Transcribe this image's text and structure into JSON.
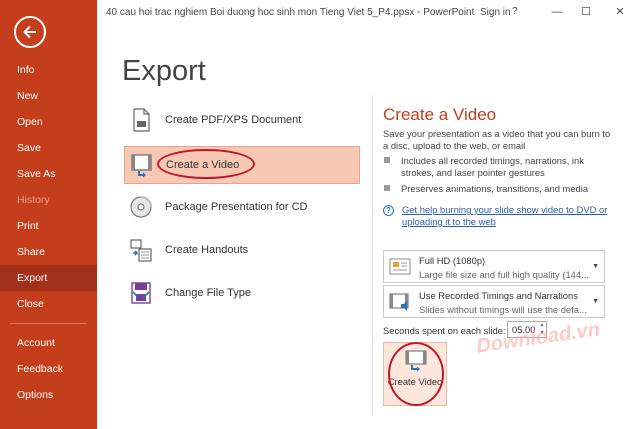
{
  "window": {
    "title": "40 cau hoi trac nghiem Boi duong hoc sinh mon Tieng Viet 5_P4.ppsx  -  PowerPoint",
    "sign_in": "Sign in",
    "help": "?",
    "minimize": "—",
    "restore": "☐",
    "close": "✕"
  },
  "colors": {
    "accent": "#c43e1c",
    "active_nav": "#a3301a",
    "selected_option": "#f7c8b3",
    "highlight_ring": "#c0172b",
    "link": "#2a5faa"
  },
  "sidebar": {
    "items": [
      {
        "label": "Info"
      },
      {
        "label": "New"
      },
      {
        "label": "Open"
      },
      {
        "label": "Save"
      },
      {
        "label": "Save As"
      },
      {
        "label": "History",
        "disabled": true
      },
      {
        "label": "Print"
      },
      {
        "label": "Share"
      },
      {
        "label": "Export",
        "active": true
      },
      {
        "label": "Close"
      },
      {
        "label": "Account"
      },
      {
        "label": "Feedback"
      },
      {
        "label": "Options"
      }
    ]
  },
  "page_title": "Export",
  "options": [
    {
      "label": "Create PDF/XPS Document",
      "icon": "pdf-document-icon"
    },
    {
      "label": "Create a Video",
      "icon": "video-icon",
      "selected": true
    },
    {
      "label": "Package Presentation for CD",
      "icon": "cd-icon"
    },
    {
      "label": "Create Handouts",
      "icon": "handouts-icon"
    },
    {
      "label": "Change File Type",
      "icon": "file-type-icon"
    }
  ],
  "right_pane": {
    "title": "Create a Video",
    "description": "Save your presentation as a video that you can burn to a disc, upload to the web, or email",
    "bullets": [
      "Includes all recorded timings, narrations, ink strokes, and laser pointer gestures",
      "Preserves animations, transitions, and media"
    ],
    "help_link": "Get help burning your slide show video to DVD or uploading it to the web",
    "quality": {
      "main": "Full HD (1080p)",
      "sub": "Large file size and full high quality (144..."
    },
    "timings": {
      "main": "Use Recorded Timings and Narrations",
      "sub": "Slides without timings will use the defa..."
    },
    "seconds_label": "Seconds spent on each slide:",
    "seconds_value": "05.00",
    "create_button": "Create Video"
  },
  "watermark": "Download.vn"
}
